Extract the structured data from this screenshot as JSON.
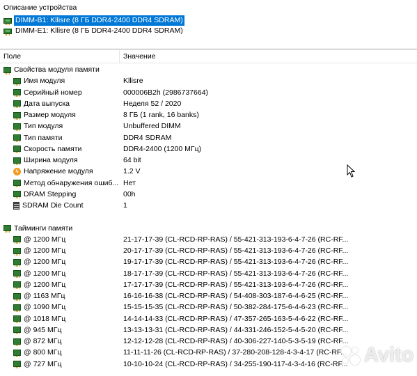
{
  "window": {
    "title": "Описание устройства"
  },
  "devices": [
    {
      "label": "DIMM-B1: Kllisre (8 ГБ DDR4-2400 DDR4 SDRAM)",
      "selected": true
    },
    {
      "label": "DIMM-E1: Kllisre (8 ГБ DDR4-2400 DDR4 SDRAM)",
      "selected": false
    }
  ],
  "columns": {
    "field": "Поле",
    "value": "Значение"
  },
  "module_props": {
    "title": "Свойства модуля памяти",
    "items": [
      {
        "field": "Имя модуля",
        "value": "Kllisre",
        "icon": "ram-chip-icon"
      },
      {
        "field": "Серийный номер",
        "value": "000006B2h (2986737664)",
        "icon": "ram-chip-icon"
      },
      {
        "field": "Дата выпуска",
        "value": "Неделя 52 / 2020",
        "icon": "ram-chip-icon"
      },
      {
        "field": "Размер модуля",
        "value": "8 ГБ (1 rank, 16 banks)",
        "icon": "ram-chip-icon"
      },
      {
        "field": "Тип модуля",
        "value": "Unbuffered DIMM",
        "icon": "ram-chip-icon"
      },
      {
        "field": "Тип памяти",
        "value": "DDR4 SDRAM",
        "icon": "ram-chip-icon"
      },
      {
        "field": "Скорость памяти",
        "value": "DDR4-2400 (1200 МГц)",
        "icon": "ram-chip-icon"
      },
      {
        "field": "Ширина модуля",
        "value": "64 bit",
        "icon": "ram-chip-icon"
      },
      {
        "field": "Напряжение модуля",
        "value": "1.2 V",
        "icon": "voltage-icon"
      },
      {
        "field": "Метод обнаружения ошиб...",
        "value": "Нет",
        "icon": "ram-chip-icon"
      },
      {
        "field": "DRAM Stepping",
        "value": "00h",
        "icon": "ram-chip-icon"
      },
      {
        "field": "SDRAM Die Count",
        "value": "1",
        "icon": "die-stack-icon"
      }
    ]
  },
  "timings": {
    "title": "Тайминги памяти",
    "items": [
      {
        "field": "@ 1200 МГц",
        "value": "21-17-17-39  (CL-RCD-RP-RAS) / 55-421-313-193-6-4-7-26  (RC-RF..."
      },
      {
        "field": "@ 1200 МГц",
        "value": "20-17-17-39  (CL-RCD-RP-RAS) / 55-421-313-193-6-4-7-26  (RC-RF..."
      },
      {
        "field": "@ 1200 МГц",
        "value": "19-17-17-39  (CL-RCD-RP-RAS) / 55-421-313-193-6-4-7-26  (RC-RF..."
      },
      {
        "field": "@ 1200 МГц",
        "value": "18-17-17-39  (CL-RCD-RP-RAS) / 55-421-313-193-6-4-7-26  (RC-RF..."
      },
      {
        "field": "@ 1200 МГц",
        "value": "17-17-17-39  (CL-RCD-RP-RAS) / 55-421-313-193-6-4-7-26  (RC-RF..."
      },
      {
        "field": "@ 1163 МГц",
        "value": "16-16-16-38  (CL-RCD-RP-RAS) / 54-408-303-187-6-4-6-25  (RC-RF..."
      },
      {
        "field": "@ 1090 МГц",
        "value": "15-15-15-35  (CL-RCD-RP-RAS) / 50-382-284-175-6-4-6-23  (RC-RF..."
      },
      {
        "field": "@ 1018 МГц",
        "value": "14-14-14-33  (CL-RCD-RP-RAS) / 47-357-265-163-5-4-6-22  (RC-RF..."
      },
      {
        "field": "@ 945 МГц",
        "value": "13-13-13-31  (CL-RCD-RP-RAS) / 44-331-246-152-5-4-5-20  (RC-RF..."
      },
      {
        "field": "@ 872 МГц",
        "value": "12-12-12-28  (CL-RCD-RP-RAS) / 40-306-227-140-5-3-5-19  (RC-RF..."
      },
      {
        "field": "@ 800 МГц",
        "value": "11-11-11-26  (CL-RCD-RP-RAS) / 37-280-208-128-4-3-4-17  (RC-RF..."
      },
      {
        "field": "@ 727 МГц",
        "value": "10-10-10-24  (CL-RCD-RP-RAS) / 34-255-190-117-4-3-4-16  (RC-RF..."
      }
    ]
  },
  "watermark": {
    "text": "Avito"
  },
  "colors": {
    "selection": "#0078d7",
    "chip_green": "#2f7d32",
    "voltage_orange": "#f29b1e"
  }
}
